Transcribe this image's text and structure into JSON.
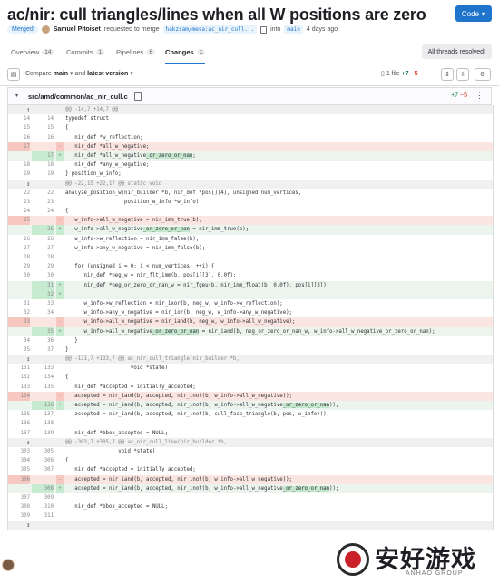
{
  "title": "ac/nir: cull triangles/lines when all W positions are zero",
  "code_button": "Code",
  "meta": {
    "status": "Merged",
    "author": "Samuel Pitoiset",
    "requested": "requested to merge",
    "source_branch": "hakzsam/mesa:ac_nir_cull...",
    "into": "into",
    "target_branch": "main",
    "time": "4 days ago"
  },
  "tabs": [
    {
      "label": "Overview",
      "count": "14"
    },
    {
      "label": "Commits",
      "count": "1"
    },
    {
      "label": "Pipelines",
      "count": "6"
    },
    {
      "label": "Changes",
      "count": "1"
    }
  ],
  "threads_button": "All threads resolved!",
  "compare": {
    "prefix": "Compare",
    "base": "main",
    "and": "and",
    "version": "latest version"
  },
  "stats": {
    "files": "1 file",
    "added": "+7",
    "removed": "−5"
  },
  "file": {
    "path": "src/amd/common/ac_nir_cull.c",
    "added": "+7",
    "removed": "−5"
  },
  "icons": {
    "sidebar": "sidebar-toggle-icon",
    "copy": "copy-icon",
    "expand": "expand-icon",
    "kebab": "more-actions-icon",
    "settings": "settings-icon",
    "caret": "caret-down-icon"
  },
  "colors": {
    "accent": "#1f75cb",
    "added_bg": "#ecf4ee",
    "removed_bg": "#fbe5e1",
    "highlight": "#c3e6cd"
  },
  "diff_lines": [
    {
      "t": "exp",
      "c": "@@ -14,7 +14,7 @@"
    },
    {
      "t": "ctx",
      "o": "14",
      "n": "14",
      "c": "typedef struct"
    },
    {
      "t": "ctx",
      "o": "15",
      "n": "15",
      "c": "{"
    },
    {
      "t": "ctx",
      "o": "16",
      "n": "16",
      "c": "   nir_def *w_reflection;"
    },
    {
      "t": "del",
      "o": "17",
      "n": "",
      "c": "   nir_def *all_w_negative;"
    },
    {
      "t": "add",
      "o": "",
      "n": "17",
      "c": "   nir_def *all_w_negative",
      "h": "_or_zero_or_nan",
      "r": ";"
    },
    {
      "t": "ctx",
      "o": "18",
      "n": "18",
      "c": "   nir_def *any_w_negative;"
    },
    {
      "t": "ctx",
      "o": "19",
      "n": "19",
      "c": "} position_w_info;"
    },
    {
      "t": "exp",
      "c": "@@ -22,15 +22,17 @@ static void"
    },
    {
      "t": "ctx",
      "o": "22",
      "n": "22",
      "c": "analyze_position_w(nir_builder *b, nir_def *pos[][4], unsigned num_vertices,"
    },
    {
      "t": "ctx",
      "o": "23",
      "n": "23",
      "c": "                   position_w_info *w_info)"
    },
    {
      "t": "ctx",
      "o": "24",
      "n": "24",
      "c": "{"
    },
    {
      "t": "del",
      "o": "25",
      "n": "",
      "c": "   w_info->all_w_negative = nir_imm_true(b);"
    },
    {
      "t": "add",
      "o": "",
      "n": "25",
      "c": "   w_info->all_w_negative",
      "h": "_or_zero_or_nan",
      "r": " = nir_imm_true(b);"
    },
    {
      "t": "ctx",
      "o": "26",
      "n": "26",
      "c": "   w_info->w_reflection = nir_imm_false(b);"
    },
    {
      "t": "ctx",
      "o": "27",
      "n": "27",
      "c": "   w_info->any_w_negative = nir_imm_false(b);"
    },
    {
      "t": "ctx",
      "o": "28",
      "n": "28",
      "c": ""
    },
    {
      "t": "ctx",
      "o": "29",
      "n": "29",
      "c": "   for (unsigned i = 0; i < num_vertices; ++i) {"
    },
    {
      "t": "ctx",
      "o": "30",
      "n": "30",
      "c": "      nir_def *neg_w = nir_flt_imm(b, pos[i][3], 0.0f);"
    },
    {
      "t": "add",
      "o": "",
      "n": "31",
      "c": "      nir_def *neg_or_zero_or_nan_w = nir_fgeu(b, nir_imm_float(b, 0.0f), pos[i][3]);"
    },
    {
      "t": "add",
      "o": "",
      "n": "32",
      "c": ""
    },
    {
      "t": "ctx",
      "o": "31",
      "n": "33",
      "c": "      w_info->w_reflection = nir_ixor(b, neg_w, w_info->w_reflection);"
    },
    {
      "t": "ctx",
      "o": "32",
      "n": "34",
      "c": "      w_info->any_w_negative = nir_ior(b, neg_w, w_info->any_w_negative);"
    },
    {
      "t": "del",
      "o": "33",
      "n": "",
      "c": "      w_info->all_w_negative = nir_iand(b, neg_w, w_info->all_w_negative);"
    },
    {
      "t": "add",
      "o": "",
      "n": "35",
      "c": "      w_info->all_w_negative",
      "h": "_or_zero_or_nan",
      "r": " = nir_iand(b, neg_or_zero_or_nan_w, w_info->all_w_negative_or_zero_or_nan);"
    },
    {
      "t": "ctx",
      "o": "34",
      "n": "36",
      "c": "   }"
    },
    {
      "t": "ctx",
      "o": "35",
      "n": "37",
      "c": "}"
    },
    {
      "t": "exp",
      "c": "@@ -131,7 +133,7 @@ ac_nir_cull_triangle(nir_builder *b,"
    },
    {
      "t": "ctx",
      "o": "131",
      "n": "133",
      "c": "                     void *state)"
    },
    {
      "t": "ctx",
      "o": "132",
      "n": "134",
      "c": "{"
    },
    {
      "t": "ctx",
      "o": "133",
      "n": "135",
      "c": "   nir_def *accepted = initially_accepted;"
    },
    {
      "t": "del",
      "o": "134",
      "n": "",
      "c": "   accepted = nir_iand(b, accepted, nir_inot(b, w_info->all_w_negative));"
    },
    {
      "t": "add",
      "o": "",
      "n": "136",
      "c": "   accepted = nir_iand(b, accepted, nir_inot(b, w_info->all_w_negative",
      "h": "_or_zero_or_nan",
      "r": "));"
    },
    {
      "t": "ctx",
      "o": "135",
      "n": "137",
      "c": "   accepted = nir_iand(b, accepted, nir_inot(b, cull_face_triangle(b, pos, w_info)));"
    },
    {
      "t": "ctx",
      "o": "136",
      "n": "138",
      "c": ""
    },
    {
      "t": "ctx",
      "o": "137",
      "n": "139",
      "c": "   nir_def *bbox_accepted = NULL;"
    },
    {
      "t": "exp",
      "c": "@@ -303,7 +305,7 @@ ac_nir_cull_line(nir_builder *b,"
    },
    {
      "t": "ctx",
      "o": "303",
      "n": "305",
      "c": "                 void *state)"
    },
    {
      "t": "ctx",
      "o": "304",
      "n": "306",
      "c": "{"
    },
    {
      "t": "ctx",
      "o": "305",
      "n": "307",
      "c": "   nir_def *accepted = initially_accepted;"
    },
    {
      "t": "del",
      "o": "306",
      "n": "",
      "c": "   accepted = nir_iand(b, accepted, nir_inot(b, w_info->all_w_negative));"
    },
    {
      "t": "add",
      "o": "",
      "n": "308",
      "c": "   accepted = nir_iand(b, accepted, nir_inot(b, w_info->all_w_negative",
      "h": "_or_zero_or_nan",
      "r": "));"
    },
    {
      "t": "ctx",
      "o": "307",
      "n": "309",
      "c": ""
    },
    {
      "t": "ctx",
      "o": "308",
      "n": "310",
      "c": "   nir_def *bbox_accepted = NULL;"
    },
    {
      "t": "ctx",
      "o": "309",
      "n": "311",
      "c": ""
    },
    {
      "t": "exp",
      "c": ""
    }
  ],
  "watermark": {
    "text": "安好游戏",
    "sub": "ANHAO GROUP"
  }
}
